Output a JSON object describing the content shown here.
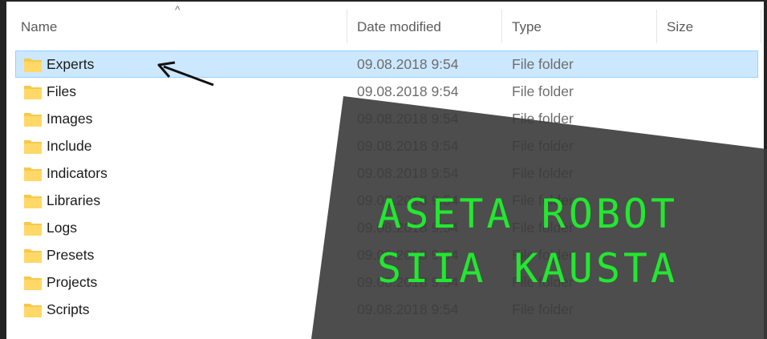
{
  "columns": {
    "name": "Name",
    "date_modified": "Date modified",
    "type": "Type",
    "size": "Size"
  },
  "files": [
    {
      "name": "Experts",
      "date": "09.08.2018 9:54",
      "type": "File folder",
      "selected": true
    },
    {
      "name": "Files",
      "date": "09.08.2018 9:54",
      "type": "File folder"
    },
    {
      "name": "Images",
      "date": "09.08.2018 9:54",
      "type": "File folder"
    },
    {
      "name": "Include",
      "date": "09.08.2018 9:54",
      "type": "File folder"
    },
    {
      "name": "Indicators",
      "date": "09.08.2018 9:54",
      "type": "File folder"
    },
    {
      "name": "Libraries",
      "date": "09.08.2018 9:54",
      "type": "File folder"
    },
    {
      "name": "Logs",
      "date": "09.08.2018 9:54",
      "type": "File folder"
    },
    {
      "name": "Presets",
      "date": "09.08.2018 9:54",
      "type": "File folder"
    },
    {
      "name": "Projects",
      "date": "09.08.2018 9:54",
      "type": "File folder"
    },
    {
      "name": "Scripts",
      "date": "09.08.2018 9:54",
      "type": "File folder"
    }
  ],
  "annotation": {
    "line1": "ASETA ROBOT",
    "line2": "SIIA KAUSTA"
  },
  "colors": {
    "selection": "#cce8ff",
    "folder": "#f6c94d",
    "overlay_text": "#22e830",
    "overlay_bg": "#3a3a3a"
  },
  "icons": {
    "folder": "folder-icon",
    "sort": "sort-up-icon",
    "pointer": "arrow-icon"
  }
}
